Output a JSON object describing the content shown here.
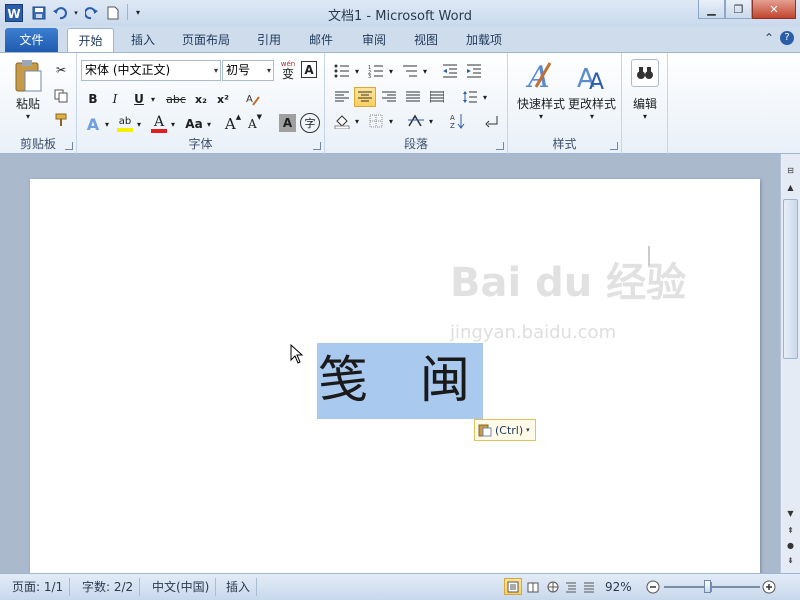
{
  "window": {
    "title": "文档1 - Microsoft Word",
    "app_icon": "W",
    "controls": [
      "minimize-icon",
      "restore-icon",
      "close-icon"
    ]
  },
  "tabs": {
    "file": "文件",
    "items": [
      "开始",
      "插入",
      "页面布局",
      "引用",
      "邮件",
      "审阅",
      "视图",
      "加载项"
    ]
  },
  "ribbon": {
    "clipboard": {
      "label": "剪贴板",
      "paste": "粘贴"
    },
    "font": {
      "label": "字体",
      "font_name": "宋体 (中文正文)",
      "font_size": "初号",
      "bold": "B",
      "italic": "I",
      "underline": "U",
      "strike": "abc",
      "sub": "x₂",
      "sup": "x²",
      "change_case": "Aa",
      "grow": "A",
      "shrink": "A",
      "highlight": "ab",
      "font_color": "A",
      "char_shade": "A",
      "enclose": "字",
      "phonetic": "wén",
      "phonetic_char": "变",
      "border_char": "A"
    },
    "paragraph": {
      "label": "段落"
    },
    "styles": {
      "label": "样式",
      "quick": "快速样式",
      "change": "更改样式"
    },
    "editing": {
      "label": "编辑"
    }
  },
  "document": {
    "char1": "笺",
    "char2": "闽",
    "paste_options": "(Ctrl)",
    "watermark_logo": "Bai du 经验",
    "watermark_url": "jingyan.baidu.com"
  },
  "status": {
    "page": "页面: 1/1",
    "words": "字数: 2/2",
    "lang": "中文(中国)",
    "mode": "插入",
    "zoom": "92%"
  }
}
